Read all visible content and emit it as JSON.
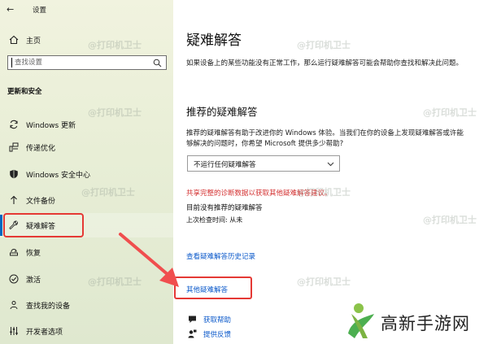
{
  "window": {
    "app_title": "设置"
  },
  "sidebar": {
    "home_label": "主页",
    "search_placeholder": "查找设置",
    "section_title": "更新和安全",
    "items": [
      {
        "label": "Windows 更新",
        "icon": "sync-icon"
      },
      {
        "label": "传递优化",
        "icon": "delivery-optimization-icon"
      },
      {
        "label": "Windows 安全中心",
        "icon": "shield-icon"
      },
      {
        "label": "文件备份",
        "icon": "backup-arrow-icon"
      },
      {
        "label": "疑难解答",
        "icon": "wrench-icon"
      },
      {
        "label": "恢复",
        "icon": "recovery-icon"
      },
      {
        "label": "激活",
        "icon": "check-circle-icon"
      },
      {
        "label": "查找我的设备",
        "icon": "person-pin-icon"
      },
      {
        "label": "开发者选项",
        "icon": "developer-sliders-icon"
      }
    ],
    "selected_index": 4
  },
  "main": {
    "title": "疑难解答",
    "description": "如果设备上的某些功能没有正常工作，那么运行疑难解答可能会帮助你查找和解决此问题。",
    "recommended_title": "推荐的疑难解答",
    "recommended_desc": "推荐的疑难解答有助于改进你的 Windows 体验。当我们在你的设备上发现疑难解答或许能够解决的问题时，你希望 Microsoft 提供多少帮助?",
    "dropdown_value": "不运行任何疑难解答",
    "share_diag_text": "共享完整的诊断数据以获取其他疑难解答建议。",
    "no_recommended": "目前没有推荐的疑难解答",
    "last_check": "上次检查时间: 从未",
    "history_link": "查看疑难解答历史记录",
    "other_link": "其他疑难解答",
    "help_links": [
      {
        "label": "获取帮助",
        "icon": "chat-help-icon"
      },
      {
        "label": "提供反馈",
        "icon": "feedback-person-icon"
      }
    ]
  },
  "watermark": "@打印机卫士",
  "logo": {
    "text": "高新手游网"
  },
  "colors": {
    "accent": "#0067c0",
    "link": "#0a58ca",
    "highlight_red": "#e53935",
    "warning_text": "#d32f2f"
  }
}
